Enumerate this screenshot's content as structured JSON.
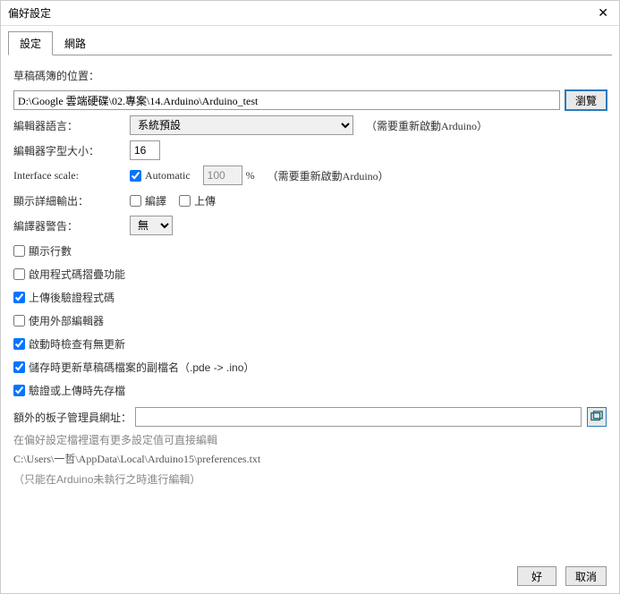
{
  "window": {
    "title": "偏好設定",
    "close": "✕"
  },
  "tabs": {
    "settings": "設定",
    "network": "網路"
  },
  "sketchbook": {
    "label": "草稿碼簿的位置：",
    "path": "D:\\Google 雲端硬碟\\02.專案\\14.Arduino\\Arduino_test",
    "browse": "瀏覽"
  },
  "language": {
    "label": "編輯器語言：",
    "value": "系統預設",
    "hint": "（需要重新啟動Arduino）"
  },
  "fontsize": {
    "label": "編輯器字型大小：",
    "value": "16"
  },
  "scale": {
    "label": "Interface scale:",
    "auto": "Automatic",
    "value": "100",
    "pct": "%",
    "hint": "（需要重新啟動Arduino）"
  },
  "verbose": {
    "label": "顯示詳細輸出：",
    "compile": "編譯",
    "upload": "上傳"
  },
  "warnings": {
    "label": "編譯器警告：",
    "value": "無"
  },
  "checks": {
    "lines": "顯示行數",
    "folding": "啟用程式碼摺疊功能",
    "verify": "上傳後驗證程式碼",
    "external": "使用外部編輯器",
    "update": "啟動時檢查有無更新",
    "assoc": "儲存時更新草稿碼檔案的副檔名（.pde -> .ino）",
    "saveverify": "驗證或上傳時先存檔"
  },
  "boards": {
    "label": "額外的板子管理員網址：",
    "value": ""
  },
  "notes": {
    "more": "在偏好設定檔裡還有更多設定值可直接編輯",
    "path": "C:\\Users\\一哲\\AppData\\Local\\Arduino15\\preferences.txt",
    "warn": "（只能在Arduino未執行之時進行編輯）"
  },
  "footer": {
    "ok": "好",
    "cancel": "取消"
  }
}
